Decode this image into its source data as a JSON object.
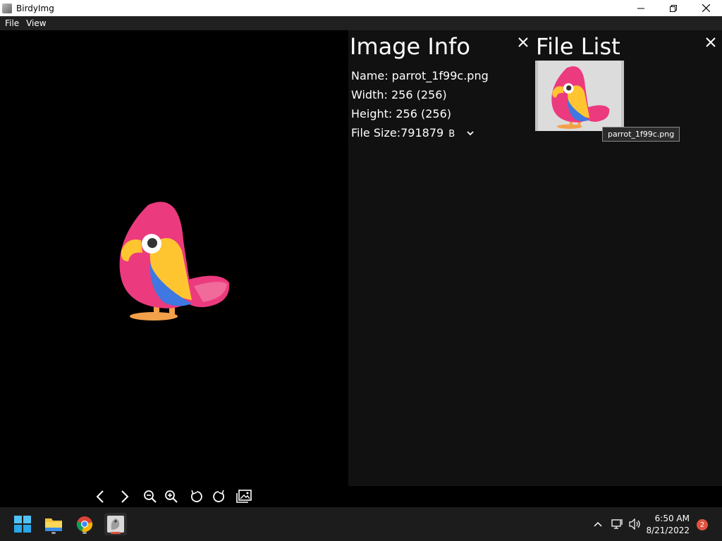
{
  "window": {
    "title": "BirdyImg",
    "controls": [
      "minimize",
      "maximize",
      "close"
    ]
  },
  "menu": {
    "items": [
      {
        "label": "File"
      },
      {
        "label": "View"
      }
    ]
  },
  "viewer": {
    "image_icon": "parrot-image"
  },
  "info_panel": {
    "title": "Image Info",
    "name_line": "Name: parrot_1f99c.png",
    "width_line": "Width: 256 (256)",
    "height_line": "Height: 256 (256)",
    "size_label": "File Size:",
    "size_value": "791879",
    "size_unit": "B"
  },
  "file_list": {
    "title": "File List",
    "items": [
      {
        "tooltip": "parrot_1f99c.png"
      }
    ]
  },
  "toolbar": {
    "buttons": [
      "previous",
      "next",
      "zoom-out",
      "zoom-in",
      "rotate-left",
      "rotate-right",
      "gallery"
    ]
  },
  "taskbar": {
    "time": "6:50 AM",
    "date": "8/21/2022",
    "notification_count": "2"
  },
  "colors": {
    "accent_badge": "#e0533f",
    "panel_bg": "#111111",
    "taskbar_bg": "#1c1c1c",
    "parrot_pink": "#ec3a7e",
    "parrot_yellow": "#ffc531",
    "parrot_blue": "#3e78e0"
  }
}
